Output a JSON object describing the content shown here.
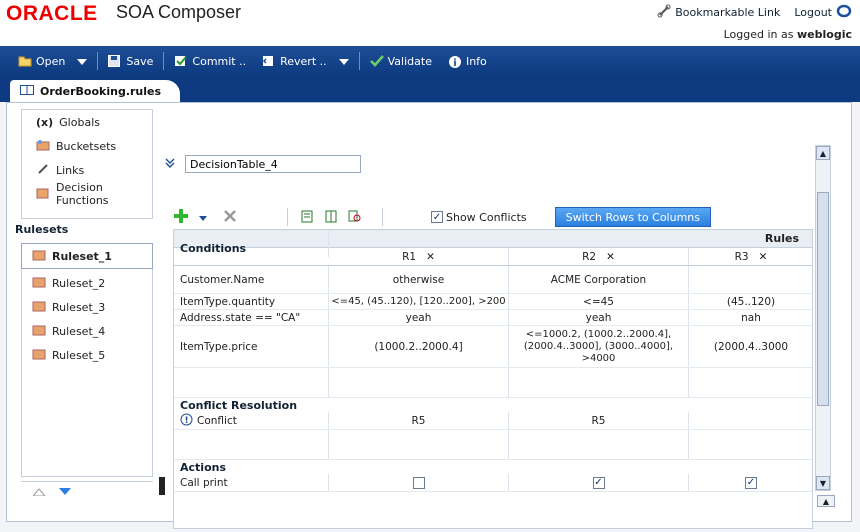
{
  "header": {
    "brand": "ORACLE",
    "product": "SOA Composer",
    "bookmark_label": "Bookmarkable Link",
    "logout_label": "Logout",
    "logged_in_prefix": "Logged in as",
    "user": "weblogic"
  },
  "toolbar": {
    "open": "Open",
    "save": "Save",
    "commit": "Commit ..",
    "revert": "Revert ..",
    "validate": "Validate",
    "info": "Info"
  },
  "tab": {
    "label": "OrderBooking.rules"
  },
  "nav": {
    "items": [
      "Globals",
      "Bucketsets",
      "Links",
      "Decision Functions"
    ],
    "rulesets_heading": "Rulesets",
    "rulesets": [
      "Ruleset_1",
      "Ruleset_2",
      "Ruleset_3",
      "Ruleset_4",
      "Ruleset_5"
    ],
    "selected": "Ruleset_1"
  },
  "decision_table": {
    "name": "DecisionTable_4",
    "show_conflicts_label": "Show Conflicts",
    "switch_label": "Switch Rows to Columns",
    "rules_heading": "Rules",
    "conditions_heading": "Conditions",
    "columns": [
      "R1",
      "R2",
      "R3"
    ],
    "conditions": [
      {
        "name": "Customer.Name",
        "values": [
          "otherwise",
          "ACME Corporation",
          ""
        ]
      },
      {
        "name": "ItemType.quantity",
        "values": [
          "<=45, (45..120), [120..200], >200",
          "<=45",
          "(45..120)"
        ]
      },
      {
        "name": "Address.state == \"CA\"",
        "values": [
          "yeah",
          "yeah",
          "nah"
        ]
      },
      {
        "name": "ItemType.price",
        "values": [
          "(1000.2..2000.4]",
          "<=1000.2, (1000.2..2000.4], (2000.4..3000], (3000..4000], >4000",
          "(2000.4..3000"
        ]
      }
    ],
    "conflict_heading": "Conflict Resolution",
    "conflict_label": "Conflict",
    "conflict_values": [
      "R5",
      "R5",
      ""
    ],
    "actions_heading": "Actions",
    "action_label": "Call print",
    "action_checked": [
      false,
      true,
      true
    ]
  }
}
